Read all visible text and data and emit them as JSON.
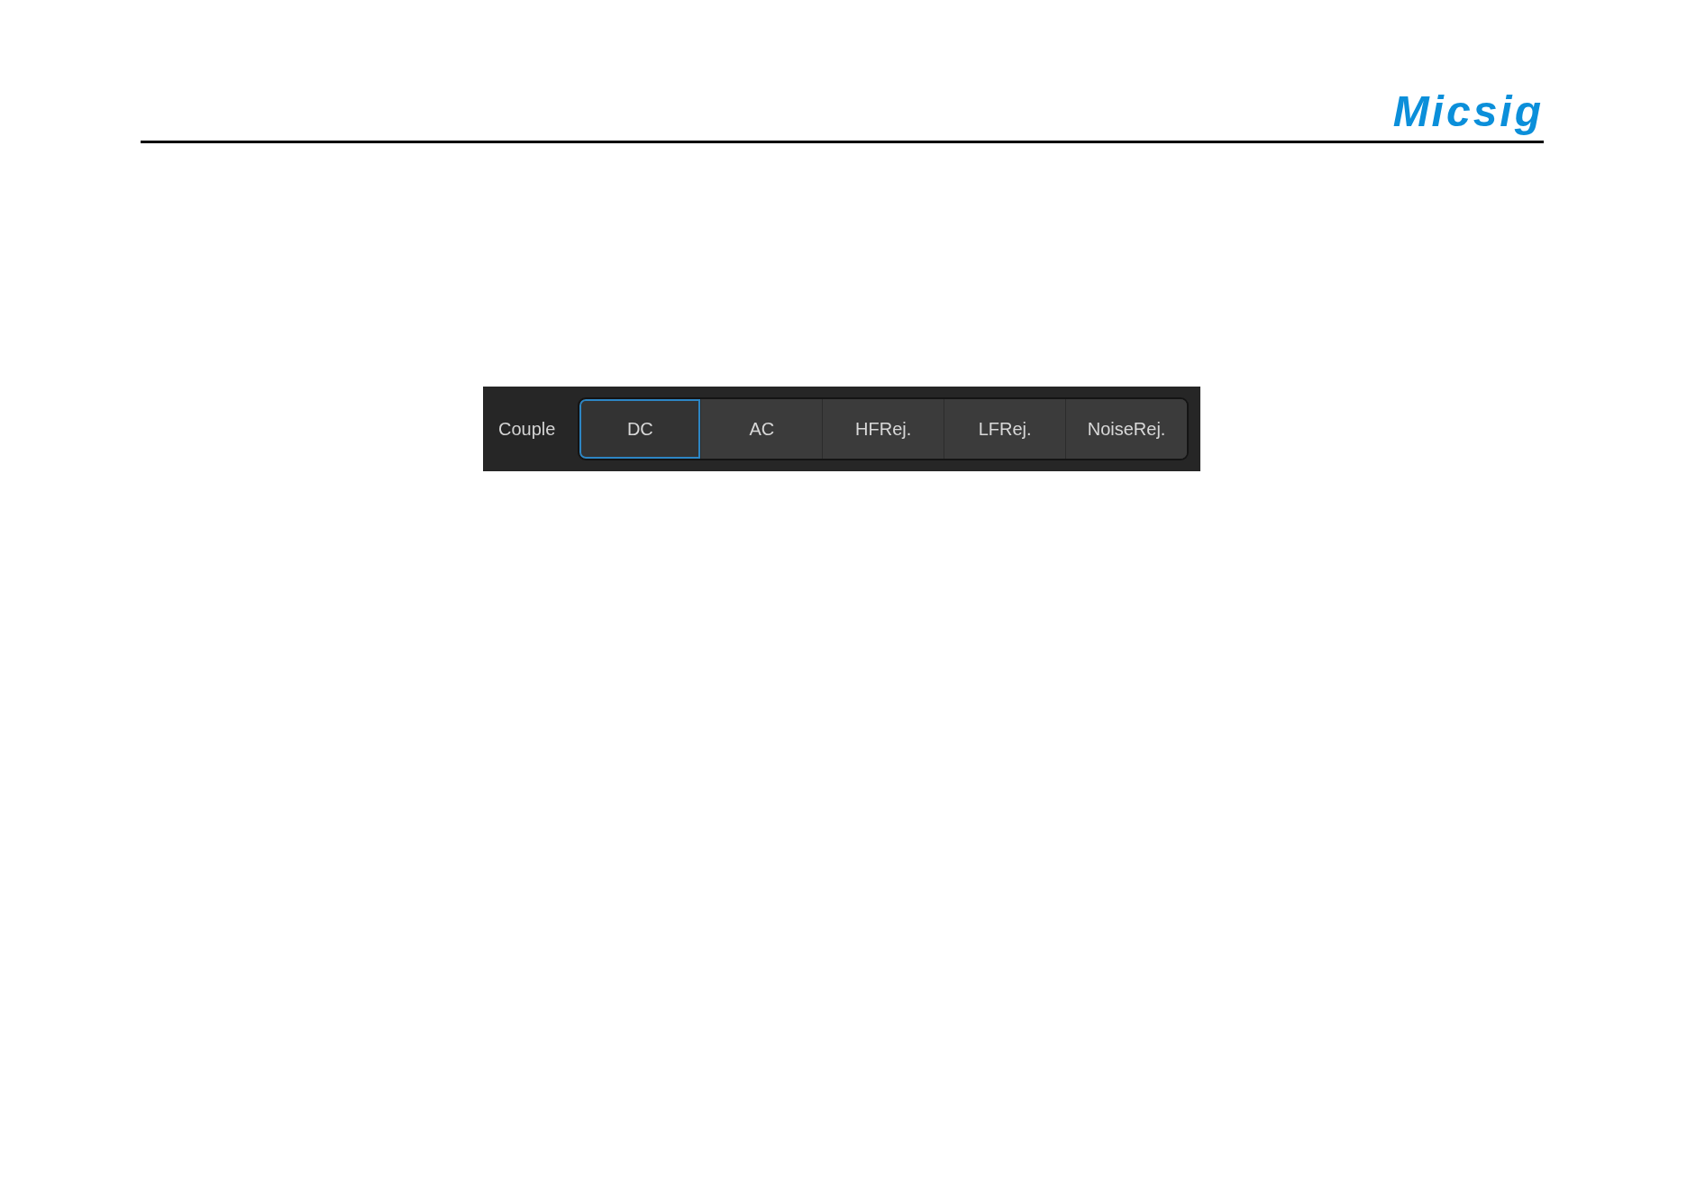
{
  "logo": {
    "text": "Micsig"
  },
  "coupling_panel": {
    "label": "Couple",
    "options": [
      {
        "label": "DC",
        "selected": true
      },
      {
        "label": "AC",
        "selected": false
      },
      {
        "label": "HFRej.",
        "selected": false
      },
      {
        "label": "LFRej.",
        "selected": false
      },
      {
        "label": "NoiseRej.",
        "selected": false
      }
    ]
  }
}
